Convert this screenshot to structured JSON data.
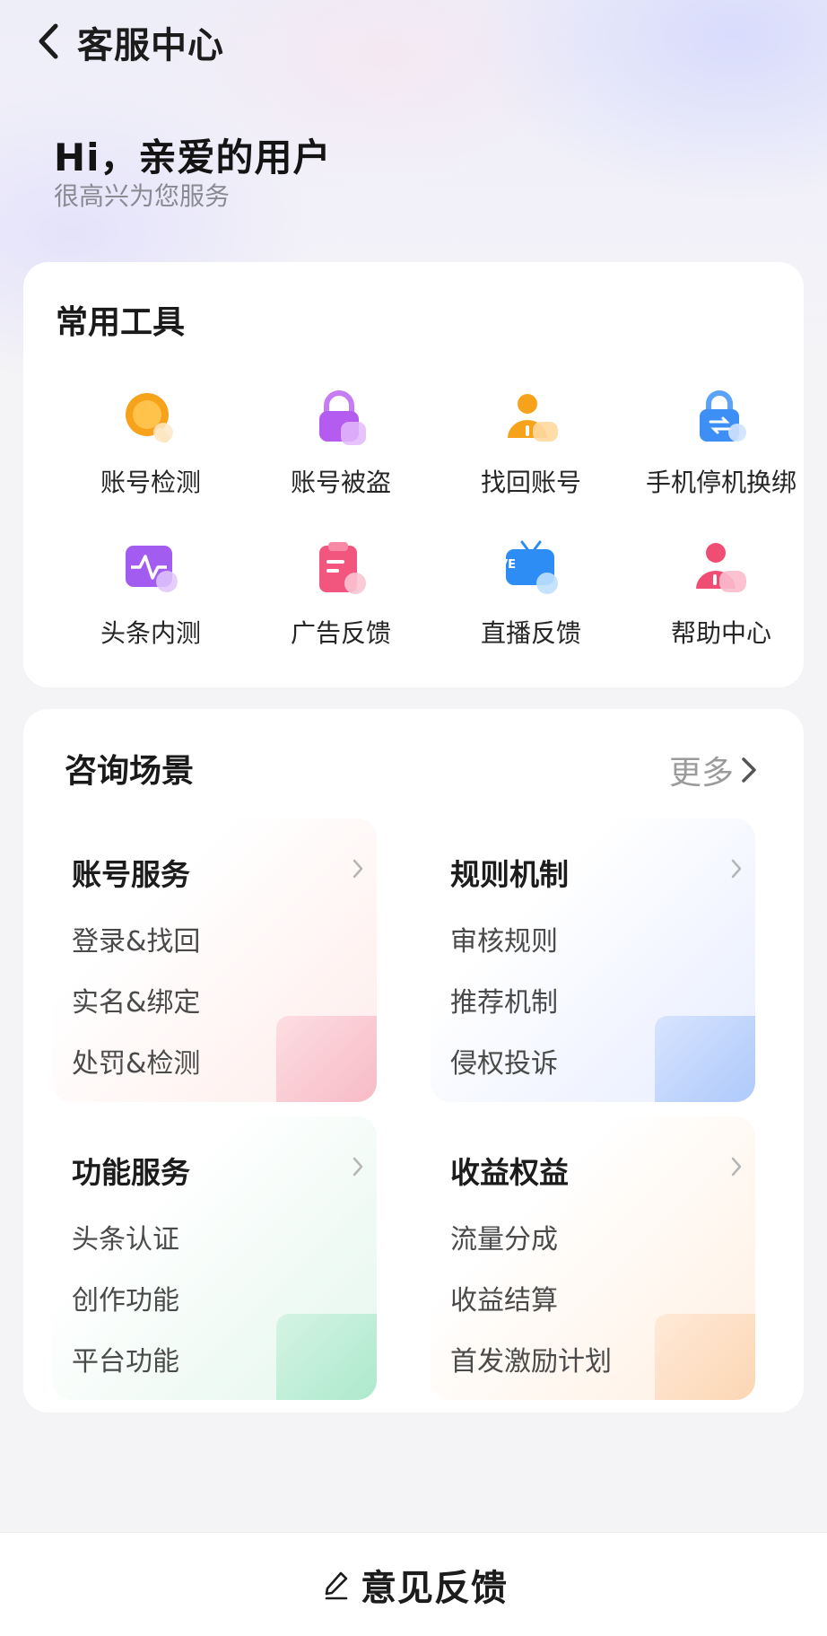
{
  "nav": {
    "title": "客服中心",
    "back_icon": "chevron-left-icon"
  },
  "greeting": {
    "title": "Hi，亲爱的用户",
    "subtitle": "很高兴为您服务"
  },
  "tools": {
    "title": "常用工具",
    "items": [
      {
        "label": "账号检测",
        "icon": "account-check-icon",
        "color": "#f7a21b"
      },
      {
        "label": "账号被盗",
        "icon": "lock-icon",
        "color": "#b45cf0"
      },
      {
        "label": "找回账号",
        "icon": "user-recover-icon",
        "color": "#f7a21b"
      },
      {
        "label": "手机停机换绑",
        "icon": "phone-rebind-icon",
        "color": "#3d8ff5"
      },
      {
        "label": "头条内测",
        "icon": "beta-test-icon",
        "color": "#a35cf0"
      },
      {
        "label": "广告反馈",
        "icon": "ad-feedback-icon",
        "color": "#f2557e"
      },
      {
        "label": "直播反馈",
        "icon": "live-feedback-icon",
        "color": "#2d8df5",
        "badge": "LIVE"
      },
      {
        "label": "帮助中心",
        "icon": "help-center-icon",
        "color": "#f04d75"
      }
    ]
  },
  "consult": {
    "title": "咨询场景",
    "more_label": "更多",
    "scenes": [
      {
        "title": "账号服务",
        "items": [
          "登录&找回",
          "实名&绑定",
          "处罚&检测"
        ],
        "accent": "#f7b6c2"
      },
      {
        "title": "规则机制",
        "items": [
          "审核规则",
          "推荐机制",
          "侵权投诉"
        ],
        "accent": "#a9c6fb"
      },
      {
        "title": "功能服务",
        "items": [
          "头条认证",
          "创作功能",
          "平台功能"
        ],
        "accent": "#a7e8c8"
      },
      {
        "title": "收益权益",
        "items": [
          "流量分成",
          "收益结算",
          "首发激励计划"
        ],
        "accent": "#fcd4b0"
      }
    ]
  },
  "footer": {
    "feedback_label": "意见反馈",
    "icon": "pencil-icon"
  }
}
